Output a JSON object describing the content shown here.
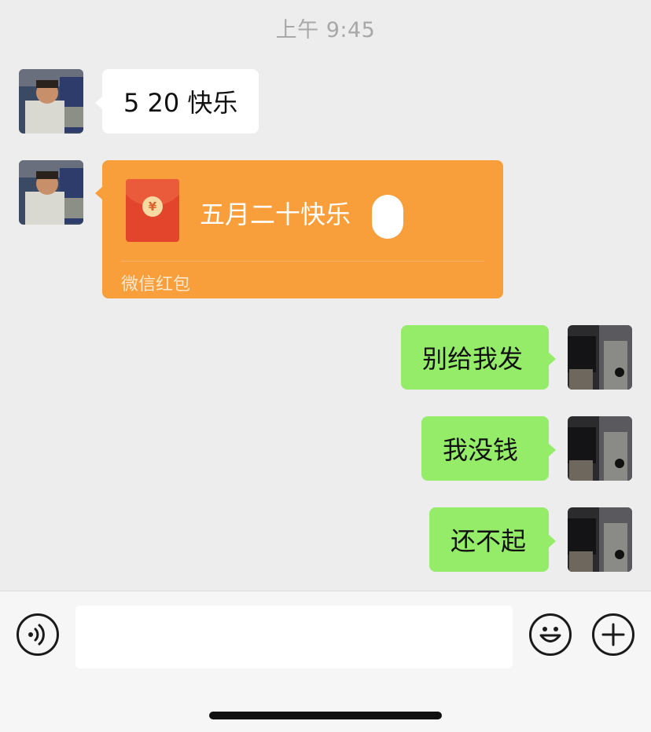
{
  "status": {
    "time": "上午 9:45"
  },
  "messages": [
    {
      "side": "left",
      "text": "5 20 快乐"
    },
    {
      "side": "left",
      "type": "red_packet",
      "title": "五月二十快乐",
      "label": "微信红包"
    },
    {
      "side": "right",
      "text": "别给我发"
    },
    {
      "side": "right",
      "text": "我没钱"
    },
    {
      "side": "right",
      "text": "还不起"
    }
  ],
  "input": {
    "value": "",
    "placeholder": ""
  },
  "colors": {
    "background": "#ededed",
    "incoming_bubble": "#ffffff",
    "outgoing_bubble": "#95ec69",
    "red_packet": "#f89e3a"
  },
  "icons": [
    "voice-icon",
    "emoji-icon",
    "plus-icon"
  ]
}
